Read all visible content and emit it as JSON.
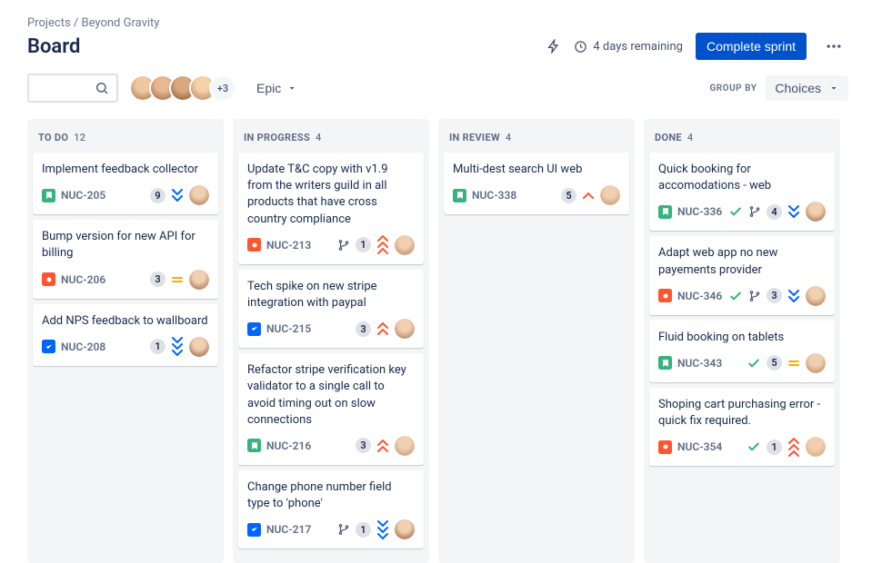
{
  "breadcrumb": {
    "parent": "Projects",
    "current": "Beyond Gravity"
  },
  "page_title": "Board",
  "header": {
    "remaining": "4 days remaining",
    "complete_sprint": "Complete sprint"
  },
  "toolbar": {
    "avatar_overflow": "+3",
    "epic_label": "Epic",
    "group_by_label": "GROUP BY",
    "choices_label": "Choices"
  },
  "columns": [
    {
      "title": "TO DO",
      "count": "12",
      "cards": [
        {
          "title": "Implement feedback collector",
          "type": "story",
          "key": "NUC-205",
          "badge": "9",
          "priority": "low",
          "avatar": 1
        },
        {
          "title": "Bump version for new API for billing",
          "type": "bug",
          "key": "NUC-206",
          "badge": "3",
          "priority": "medium",
          "avatar": 2
        },
        {
          "title": "Add NPS feedback to wallboard",
          "type": "task",
          "key": "NUC-208",
          "badge": "1",
          "priority": "lowest",
          "avatar": 3
        }
      ]
    },
    {
      "title": "IN PROGRESS",
      "count": "4",
      "cards": [
        {
          "title": "Update T&C copy with v1.9 from the writers guild in all products that have cross country compliance",
          "type": "bug",
          "key": "NUC-213",
          "branch": true,
          "badge": "1",
          "priority": "highest",
          "avatar": 4
        },
        {
          "title": "Tech spike on new stripe integration with paypal",
          "type": "task",
          "key": "NUC-215",
          "badge": "3",
          "priority": "high",
          "avatar": 1
        },
        {
          "title": "Refactor stripe verification key validator to a single call to avoid timing out on slow connections",
          "type": "story",
          "key": "NUC-216",
          "badge": "3",
          "priority": "high",
          "avatar": 5
        },
        {
          "title": "Change phone number field type to 'phone'",
          "type": "task",
          "key": "NUC-217",
          "branch": true,
          "badge": "1",
          "priority": "lowest",
          "avatar": 3
        }
      ]
    },
    {
      "title": "IN REVIEW",
      "count": "4",
      "cards": [
        {
          "title": "Multi-dest search UI web",
          "type": "story",
          "key": "NUC-338",
          "badge": "5",
          "priority": "high-single",
          "avatar": 5
        }
      ]
    },
    {
      "title": "DONE",
      "count": "4",
      "cards": [
        {
          "title": "Quick booking for accomodations - web",
          "type": "story",
          "key": "NUC-336",
          "done": true,
          "branch": true,
          "badge": "4",
          "priority": "low",
          "avatar": 2
        },
        {
          "title": "Adapt web app no new payements provider",
          "type": "bug",
          "key": "NUC-346",
          "done": true,
          "branch": true,
          "badge": "3",
          "priority": "low",
          "avatar": 1
        },
        {
          "title": "Fluid booking on tablets",
          "type": "story",
          "key": "NUC-343",
          "done": true,
          "badge": "5",
          "priority": "medium",
          "avatar": 4
        },
        {
          "title": "Shoping cart purchasing error - quick fix required.",
          "type": "bug",
          "key": "NUC-354",
          "done": true,
          "badge": "1",
          "priority": "highest",
          "avatar": 6
        }
      ]
    }
  ]
}
